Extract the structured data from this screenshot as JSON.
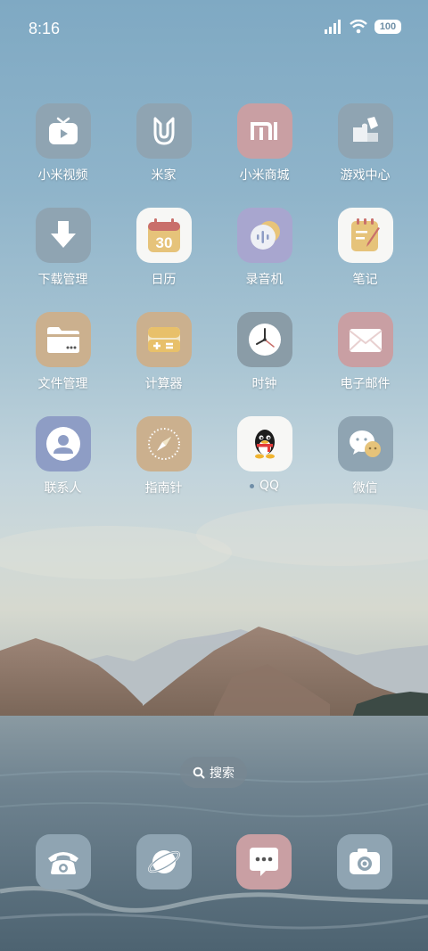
{
  "status_bar": {
    "time": "8:16",
    "battery": "100"
  },
  "apps": [
    {
      "label": "小米视频",
      "icon": "video-icon",
      "bg": "#8fa4b2"
    },
    {
      "label": "米家",
      "icon": "mijia-icon",
      "bg": "#8fa4b2"
    },
    {
      "label": "小米商城",
      "icon": "mi-store-icon",
      "bg": "#c99fa3"
    },
    {
      "label": "游戏中心",
      "icon": "puzzle-icon",
      "bg": "#8fa4b2"
    },
    {
      "label": "下载管理",
      "icon": "download-icon",
      "bg": "#8fa4b2"
    },
    {
      "label": "日历",
      "icon": "calendar-icon",
      "bg": "#f7f7f5",
      "cal_day": "30"
    },
    {
      "label": "录音机",
      "icon": "recorder-icon",
      "bg": "#a8a6cf"
    },
    {
      "label": "笔记",
      "icon": "notes-icon",
      "bg": "#f7f7f5"
    },
    {
      "label": "文件管理",
      "icon": "folder-icon",
      "bg": "#cbb08e"
    },
    {
      "label": "计算器",
      "icon": "calculator-icon",
      "bg": "#cbb08e"
    },
    {
      "label": "时钟",
      "icon": "clock-icon",
      "bg": "#8a9ca7"
    },
    {
      "label": "电子邮件",
      "icon": "mail-icon",
      "bg": "#c99fa3"
    },
    {
      "label": "联系人",
      "icon": "contacts-icon",
      "bg": "#8e9dc5"
    },
    {
      "label": "指南针",
      "icon": "compass-icon",
      "bg": "#cbb08e"
    },
    {
      "label": "QQ",
      "icon": "qq-penguin-icon",
      "bg": "#f7f7f5"
    },
    {
      "label": "微信",
      "icon": "wechat-icon",
      "bg": "#8fa4b2"
    }
  ],
  "search": {
    "label": "搜索"
  },
  "dock": [
    {
      "icon": "phone-icon",
      "bg": "#8fa4b2"
    },
    {
      "icon": "browser-planet-icon",
      "bg": "#8fa4b2"
    },
    {
      "icon": "messages-icon",
      "bg": "#c99fa3"
    },
    {
      "icon": "camera-icon",
      "bg": "#8fa4b2"
    }
  ]
}
